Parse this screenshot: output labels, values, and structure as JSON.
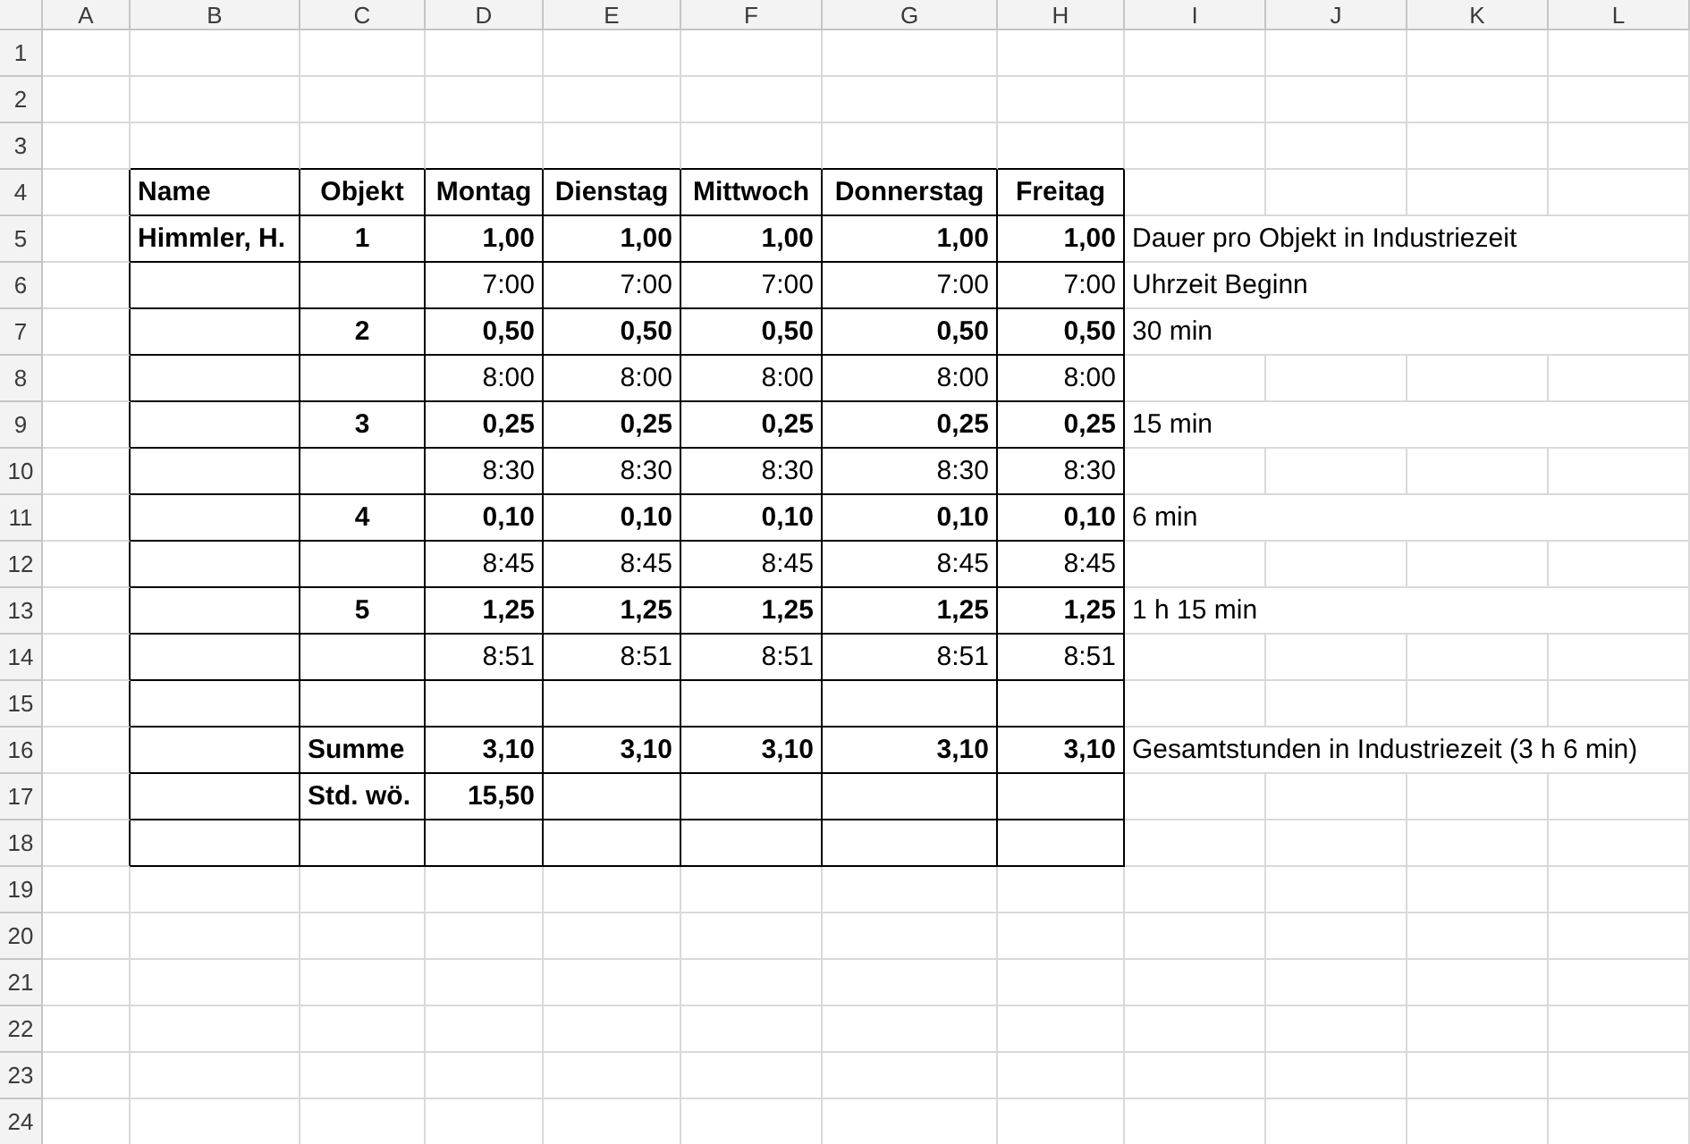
{
  "columns": [
    {
      "label": "A",
      "in_table": false
    },
    {
      "label": "B",
      "in_table": true
    },
    {
      "label": "C",
      "in_table": true
    },
    {
      "label": "D",
      "in_table": true
    },
    {
      "label": "E",
      "in_table": true
    },
    {
      "label": "F",
      "in_table": true
    },
    {
      "label": "G",
      "in_table": true
    },
    {
      "label": "H",
      "in_table": true
    },
    {
      "label": "I",
      "in_table": false
    },
    {
      "label": "J",
      "in_table": false
    },
    {
      "label": "K",
      "in_table": false
    },
    {
      "label": "L",
      "in_table": false
    }
  ],
  "rows": [
    {
      "number": "1",
      "in_table": false,
      "cells": []
    },
    {
      "number": "2",
      "in_table": false,
      "cells": []
    },
    {
      "number": "3",
      "in_table": false,
      "cells": []
    },
    {
      "number": "4",
      "in_table": true,
      "cells": [
        {
          "kind": "empty"
        },
        {
          "kind": "label",
          "text": "Name",
          "bold": true
        },
        {
          "kind": "heading",
          "text": "Objekt",
          "bold": true
        },
        {
          "kind": "heading",
          "text": "Montag",
          "bold": true
        },
        {
          "kind": "heading",
          "text": "Dienstag",
          "bold": true
        },
        {
          "kind": "heading",
          "text": "Mittwoch",
          "bold": true
        },
        {
          "kind": "heading",
          "text": "Donnerstag",
          "bold": true
        },
        {
          "kind": "heading",
          "text": "Freitag",
          "bold": true
        }
      ]
    },
    {
      "number": "5",
      "in_table": true,
      "cells": [
        {
          "kind": "empty"
        },
        {
          "kind": "label",
          "text": "Himmler, H.",
          "bold": true
        },
        {
          "kind": "heading",
          "text": "1",
          "bold": true
        },
        {
          "kind": "number",
          "text": "1,00",
          "bold": true
        },
        {
          "kind": "number",
          "text": "1,00",
          "bold": true
        },
        {
          "kind": "number",
          "text": "1,00",
          "bold": true
        },
        {
          "kind": "number",
          "text": "1,00",
          "bold": true
        },
        {
          "kind": "number",
          "text": "1,00",
          "bold": true
        },
        {
          "kind": "label",
          "text": "Dauer pro Objekt in Industriezeit",
          "bold": false
        }
      ]
    },
    {
      "number": "6",
      "in_table": true,
      "cells": [
        {
          "kind": "empty"
        },
        {
          "kind": "empty"
        },
        {
          "kind": "empty"
        },
        {
          "kind": "number",
          "text": "7:00",
          "bold": false
        },
        {
          "kind": "number",
          "text": "7:00",
          "bold": false
        },
        {
          "kind": "number",
          "text": "7:00",
          "bold": false
        },
        {
          "kind": "number",
          "text": "7:00",
          "bold": false
        },
        {
          "kind": "number",
          "text": "7:00",
          "bold": false
        },
        {
          "kind": "label",
          "text": "Uhrzeit Beginn",
          "bold": false
        }
      ]
    },
    {
      "number": "7",
      "in_table": true,
      "cells": [
        {
          "kind": "empty"
        },
        {
          "kind": "empty"
        },
        {
          "kind": "heading",
          "text": "2",
          "bold": true
        },
        {
          "kind": "number",
          "text": "0,50",
          "bold": true
        },
        {
          "kind": "number",
          "text": "0,50",
          "bold": true
        },
        {
          "kind": "number",
          "text": "0,50",
          "bold": true
        },
        {
          "kind": "number",
          "text": "0,50",
          "bold": true
        },
        {
          "kind": "number",
          "text": "0,50",
          "bold": true
        },
        {
          "kind": "label",
          "text": "30 min",
          "bold": false
        }
      ]
    },
    {
      "number": "8",
      "in_table": true,
      "cells": [
        {
          "kind": "empty"
        },
        {
          "kind": "empty"
        },
        {
          "kind": "empty"
        },
        {
          "kind": "number",
          "text": "8:00",
          "bold": false
        },
        {
          "kind": "number",
          "text": "8:00",
          "bold": false
        },
        {
          "kind": "number",
          "text": "8:00",
          "bold": false
        },
        {
          "kind": "number",
          "text": "8:00",
          "bold": false
        },
        {
          "kind": "number",
          "text": "8:00",
          "bold": false
        }
      ]
    },
    {
      "number": "9",
      "in_table": true,
      "cells": [
        {
          "kind": "empty"
        },
        {
          "kind": "empty"
        },
        {
          "kind": "heading",
          "text": "3",
          "bold": true
        },
        {
          "kind": "number",
          "text": "0,25",
          "bold": true
        },
        {
          "kind": "number",
          "text": "0,25",
          "bold": true
        },
        {
          "kind": "number",
          "text": "0,25",
          "bold": true
        },
        {
          "kind": "number",
          "text": "0,25",
          "bold": true
        },
        {
          "kind": "number",
          "text": "0,25",
          "bold": true
        },
        {
          "kind": "label",
          "text": "15 min",
          "bold": false
        }
      ]
    },
    {
      "number": "10",
      "in_table": true,
      "cells": [
        {
          "kind": "empty"
        },
        {
          "kind": "empty"
        },
        {
          "kind": "empty"
        },
        {
          "kind": "number",
          "text": "8:30",
          "bold": false
        },
        {
          "kind": "number",
          "text": "8:30",
          "bold": false
        },
        {
          "kind": "number",
          "text": "8:30",
          "bold": false
        },
        {
          "kind": "number",
          "text": "8:30",
          "bold": false
        },
        {
          "kind": "number",
          "text": "8:30",
          "bold": false
        }
      ]
    },
    {
      "number": "11",
      "in_table": true,
      "cells": [
        {
          "kind": "empty"
        },
        {
          "kind": "empty"
        },
        {
          "kind": "heading",
          "text": "4",
          "bold": true
        },
        {
          "kind": "number",
          "text": "0,10",
          "bold": true
        },
        {
          "kind": "number",
          "text": "0,10",
          "bold": true
        },
        {
          "kind": "number",
          "text": "0,10",
          "bold": true
        },
        {
          "kind": "number",
          "text": "0,10",
          "bold": true
        },
        {
          "kind": "number",
          "text": "0,10",
          "bold": true
        },
        {
          "kind": "label",
          "text": "6 min",
          "bold": false
        }
      ]
    },
    {
      "number": "12",
      "in_table": true,
      "cells": [
        {
          "kind": "empty"
        },
        {
          "kind": "empty"
        },
        {
          "kind": "empty"
        },
        {
          "kind": "number",
          "text": "8:45",
          "bold": false
        },
        {
          "kind": "number",
          "text": "8:45",
          "bold": false
        },
        {
          "kind": "number",
          "text": "8:45",
          "bold": false
        },
        {
          "kind": "number",
          "text": "8:45",
          "bold": false
        },
        {
          "kind": "number",
          "text": "8:45",
          "bold": false
        }
      ]
    },
    {
      "number": "13",
      "in_table": true,
      "cells": [
        {
          "kind": "empty"
        },
        {
          "kind": "empty"
        },
        {
          "kind": "heading",
          "text": "5",
          "bold": true
        },
        {
          "kind": "number",
          "text": "1,25",
          "bold": true
        },
        {
          "kind": "number",
          "text": "1,25",
          "bold": true
        },
        {
          "kind": "number",
          "text": "1,25",
          "bold": true
        },
        {
          "kind": "number",
          "text": "1,25",
          "bold": true
        },
        {
          "kind": "number",
          "text": "1,25",
          "bold": true
        },
        {
          "kind": "label",
          "text": "1 h 15 min",
          "bold": false
        }
      ]
    },
    {
      "number": "14",
      "in_table": true,
      "cells": [
        {
          "kind": "empty"
        },
        {
          "kind": "empty"
        },
        {
          "kind": "empty"
        },
        {
          "kind": "number",
          "text": "8:51",
          "bold": false
        },
        {
          "kind": "number",
          "text": "8:51",
          "bold": false
        },
        {
          "kind": "number",
          "text": "8:51",
          "bold": false
        },
        {
          "kind": "number",
          "text": "8:51",
          "bold": false
        },
        {
          "kind": "number",
          "text": "8:51",
          "bold": false
        }
      ]
    },
    {
      "number": "15",
      "in_table": true,
      "cells": []
    },
    {
      "number": "16",
      "in_table": true,
      "cells": [
        {
          "kind": "empty"
        },
        {
          "kind": "empty"
        },
        {
          "kind": "label",
          "text": "Summe",
          "bold": true
        },
        {
          "kind": "number",
          "text": "3,10",
          "bold": true
        },
        {
          "kind": "number",
          "text": "3,10",
          "bold": true
        },
        {
          "kind": "number",
          "text": "3,10",
          "bold": true
        },
        {
          "kind": "number",
          "text": "3,10",
          "bold": true
        },
        {
          "kind": "number",
          "text": "3,10",
          "bold": true
        },
        {
          "kind": "label",
          "text": "Gesamtstunden in Industriezeit (3 h 6 min)",
          "bold": false
        }
      ]
    },
    {
      "number": "17",
      "in_table": true,
      "cells": [
        {
          "kind": "empty"
        },
        {
          "kind": "empty"
        },
        {
          "kind": "label",
          "text": "Std. wö.",
          "bold": true
        },
        {
          "kind": "number",
          "text": "15,50",
          "bold": true
        }
      ]
    },
    {
      "number": "18",
      "in_table": true,
      "cells": []
    },
    {
      "number": "19",
      "in_table": false,
      "cells": []
    },
    {
      "number": "20",
      "in_table": false,
      "cells": []
    },
    {
      "number": "21",
      "in_table": false,
      "cells": []
    },
    {
      "number": "22",
      "in_table": false,
      "cells": []
    },
    {
      "number": "23",
      "in_table": false,
      "cells": []
    },
    {
      "number": "24",
      "in_table": false,
      "cells": []
    }
  ]
}
